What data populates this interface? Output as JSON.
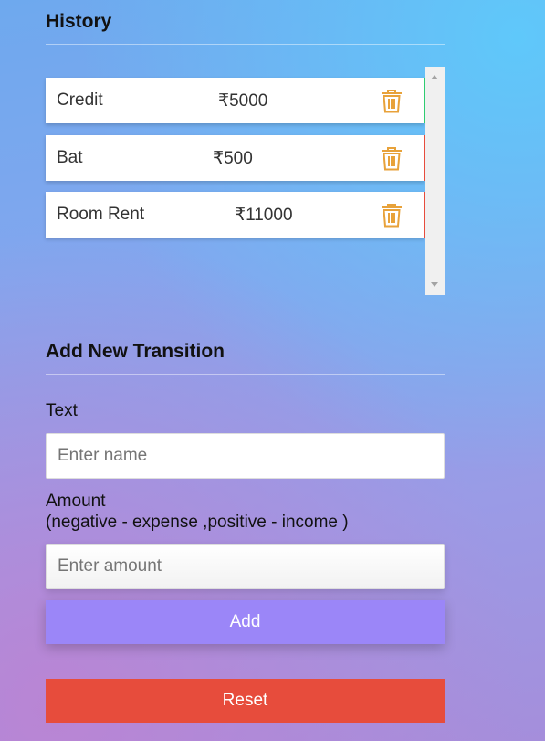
{
  "history": {
    "title": "History",
    "items": [
      {
        "text": "Credit",
        "amount": "₹5000",
        "type": "income"
      },
      {
        "text": "Bat",
        "amount": "₹500",
        "type": "expense"
      },
      {
        "text": "Room Rent",
        "amount": "₹11000",
        "type": "expense"
      }
    ]
  },
  "colors": {
    "income": "#2ecc71",
    "expense": "#e74c3c",
    "add_button": "#9b86f8",
    "reset_button": "#e74c3c",
    "trash_icon": "#e8a23a"
  },
  "icons": {
    "delete": "trash-icon"
  },
  "form": {
    "title": "Add New Transition",
    "text_label": "Text",
    "text_placeholder": "Enter name",
    "amount_label_line1": "Amount",
    "amount_label_line2": "(negative - expense ,positive - income )",
    "amount_placeholder": "Enter amount",
    "add_label": "Add",
    "reset_label": "Reset"
  }
}
